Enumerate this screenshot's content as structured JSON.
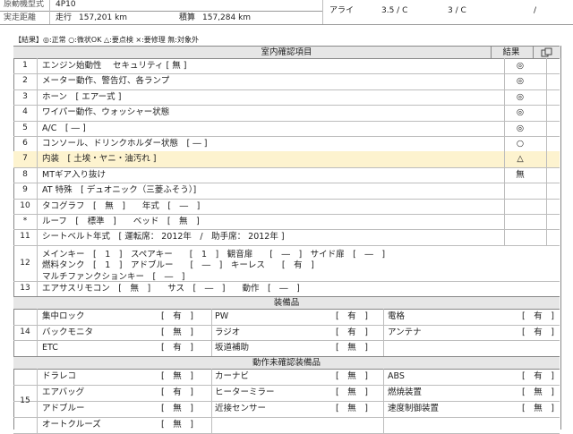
{
  "top": {
    "row1_label": "原動機型式",
    "row1_value": "4P10",
    "row2_label": "実走距離",
    "row2_meter_label": "走行",
    "row2_meter": "157,201 km",
    "row2_odo_label": "積算",
    "row2_odo": "157,284 km",
    "tire_label": "アライ",
    "tire_a": "3.5 / C",
    "tire_b": "3 / C",
    "tire_c": "/"
  },
  "legend": "【結果】◎:正常 ○:微状OK △:要点検 ×:要修理 無:対象外",
  "inspection": {
    "header": "室内確認項目",
    "result_header": "結果",
    "corner_icon": "copy-icon",
    "rows": [
      {
        "no": "1",
        "text": "エンジン始動性　 セキュリティ [ 無 ]",
        "result": "◎"
      },
      {
        "no": "2",
        "text": "メーター動作、警告灯、各ランプ",
        "result": "◎"
      },
      {
        "no": "3",
        "text": "ホーン　[ エアー式 ]",
        "result": "◎"
      },
      {
        "no": "4",
        "text": "ワイパー動作、ウォッシャー状態",
        "result": "◎"
      },
      {
        "no": "5",
        "text": "A/C　[ ― ]",
        "result": "◎"
      },
      {
        "no": "6",
        "text": "コンソール、ドリンクホルダー状態　[ ― ]",
        "result": "○"
      },
      {
        "no": "7",
        "text": "内装　[ 土埃・ヤニ・油汚れ ]",
        "result": "△"
      },
      {
        "no": "8",
        "text": "MTギア入り抜け",
        "result": "無"
      },
      {
        "no": "9",
        "text": "AT 特殊　[ デュオニック（三菱ふそう）]",
        "result": ""
      },
      {
        "no": "10",
        "text": "タコグラフ　[　無　]　　年式　[　―　]",
        "result": ""
      },
      {
        "no": "*",
        "text": "ルーフ　[　標準　]　　ベッド　[　無　]",
        "result": ""
      },
      {
        "no": "11",
        "text": "シートベルト年式　[ 運転席： 2012年　/　助手席： 2012年 ]",
        "result": ""
      }
    ],
    "row12": {
      "no": "12",
      "line1": "メインキー　[　1　]　スペアキー　　[　1　]　観音扉　　[　―　]　サイド扉　[　―　]",
      "line2": "燃料タンク　[　1　]　アドブルー　　[　―　]　キーレス　　[　有　]",
      "line3": "マルチファンクションキー　[　―　]"
    },
    "row13": {
      "no": "13",
      "text": "エアサスリモコン　[　無　]　　サス　[　―　]　　動作　[　―　]"
    }
  },
  "equipment": {
    "header": "装備品",
    "no": "14",
    "rows": [
      [
        {
          "name": "集中ロック",
          "val": "[　有　]"
        },
        {
          "name": "PW",
          "val": "[　有　]"
        },
        {
          "name": "電格",
          "val": "[　有　]"
        }
      ],
      [
        {
          "name": "バックモニタ",
          "val": "[　無　]"
        },
        {
          "name": "ラジオ",
          "val": "[　有　]"
        },
        {
          "name": "アンテナ",
          "val": "[　有　]"
        }
      ],
      [
        {
          "name": "ETC",
          "val": "[　有　]"
        },
        {
          "name": "坂道補助",
          "val": "[　無　]"
        },
        {
          "name": "",
          "val": ""
        }
      ]
    ]
  },
  "unconfirmed": {
    "header": "動作未確認装備品",
    "no": "15",
    "rows": [
      [
        {
          "name": "ドラレコ",
          "val": "[　無　]"
        },
        {
          "name": "カーナビ",
          "val": "[　無　]"
        },
        {
          "name": "ABS",
          "val": "[　有　]"
        }
      ],
      [
        {
          "name": "エアバッグ",
          "val": "[　有　]"
        },
        {
          "name": "ヒーターミラー",
          "val": "[　無　]"
        },
        {
          "name": "燃焼装置",
          "val": "[　無　]"
        }
      ],
      [
        {
          "name": "アドブルー",
          "val": "[　無　]"
        },
        {
          "name": "近接センサー",
          "val": "[　無　]"
        },
        {
          "name": "速度制御装置",
          "val": "[　無　]"
        }
      ],
      [
        {
          "name": "オートクルーズ",
          "val": "[　無　]"
        },
        {
          "name": "",
          "val": ""
        },
        {
          "name": "",
          "val": ""
        }
      ]
    ]
  },
  "colors": {
    "highlight": "#fdf3cf",
    "section": "#e6e6e6"
  }
}
